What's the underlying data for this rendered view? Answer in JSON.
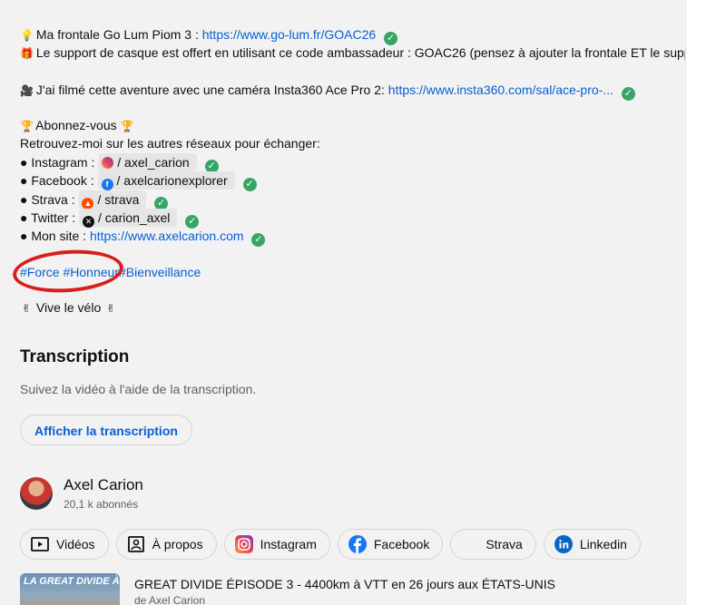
{
  "description": {
    "lamp_line": {
      "text": "Ma frontale Go Lum Piom 3 : ",
      "link": "https://www.go-lum.fr/GOAC26"
    },
    "support_line": {
      "text": "Le support de casque est offert en utilisant ce code ambassadeur : GOAC26 (pensez à ajouter la frontale ET le support"
    },
    "camera_line": {
      "text": "J'ai filmé cette aventure avec une caméra Insta360 Ace Pro 2: ",
      "link": "https://www.insta360.com/sal/ace-pro-..."
    },
    "subscribe": "Abonnez-vous",
    "networks_intro": "Retrouvez-moi sur les autres réseaux pour échanger:",
    "socials": [
      {
        "label": "● Instagram : ",
        "handle": "/ axel_carion"
      },
      {
        "label": "● Facebook : ",
        "handle": "/ axelcarionexplorer"
      },
      {
        "label": "● Strava : ",
        "handle": "/ strava"
      },
      {
        "label": "● Twitter : ",
        "handle": "/ carion_axel"
      }
    ],
    "site": {
      "label": "● Mon site : ",
      "link": "https://www.axelcarion.com"
    },
    "hashtags": [
      "#Force",
      "#Honneur",
      "#Bienveillance"
    ],
    "vive": "Vive le vélo"
  },
  "transcription": {
    "heading": "Transcription",
    "subtitle": "Suivez la vidéo à l'aide de la transcription.",
    "button": "Afficher la transcription"
  },
  "channel": {
    "name": "Axel Carion",
    "subscribers": "20,1 k abonnés",
    "buttons": [
      "Vidéos",
      "À propos",
      "Instagram",
      "Facebook",
      "Strava",
      "Linkedin"
    ]
  },
  "video": {
    "thumb_text": "LA GREAT DIVIDE À VTT",
    "title": "GREAT DIVIDE ÉPISODE 3 - 4400km à VTT en 26 jours aux ÉTATS-UNIS",
    "by": "de Axel Carion"
  },
  "colors": {
    "link": "#065fd4",
    "check": "#36a567",
    "highlight": "#d81e1e"
  }
}
